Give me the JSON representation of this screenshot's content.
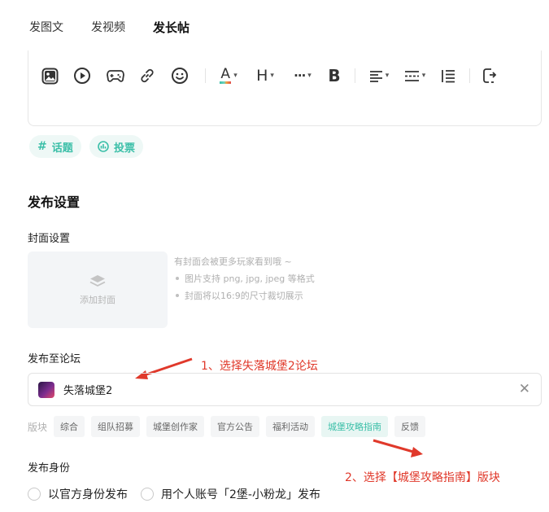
{
  "tabs": [
    {
      "label": "发图文"
    },
    {
      "label": "发视频"
    },
    {
      "label": "发长帖"
    }
  ],
  "toolbar": {
    "icons": [
      "image-icon",
      "video-icon",
      "gamepad-icon",
      "link-icon",
      "emoji-icon",
      "font-color-icon",
      "heading-icon",
      "more-icon",
      "bold-icon",
      "align-icon",
      "divider-icon",
      "list-icon",
      "redo-icon"
    ],
    "font_color_letter": "A",
    "heading_letter": "H",
    "more_glyph": "···",
    "bold_letter": "B",
    "font_color_accent": "#3bbfa8"
  },
  "chips": {
    "topic": "话题",
    "vote": "投票"
  },
  "settings": {
    "title": "发布设置",
    "cover": {
      "title": "封面设置",
      "add_label": "添加封面",
      "hints": [
        "有封面会被更多玩家看到哦 ~",
        "图片支持 png, jpg, jpeg 等格式",
        "封面将以16:9的尺寸裁切展示"
      ]
    },
    "forum": {
      "title": "发布至论坛",
      "selected": "失落城堡2",
      "annotation": "1、选择失落城堡2论坛"
    },
    "boards": {
      "label": "版块",
      "items": [
        "综合",
        "组队招募",
        "城堡创作家",
        "官方公告",
        "福利活动",
        "城堡攻略指南",
        "反馈"
      ],
      "selected": "城堡攻略指南",
      "annotation": "2、选择【城堡攻略指南】版块"
    },
    "identity": {
      "title": "发布身份",
      "options": [
        "以官方身份发布",
        "用个人账号「2堡-小粉龙」发布"
      ]
    }
  },
  "colors": {
    "accent": "#3bbfa8",
    "annotation": "#e0392b"
  }
}
